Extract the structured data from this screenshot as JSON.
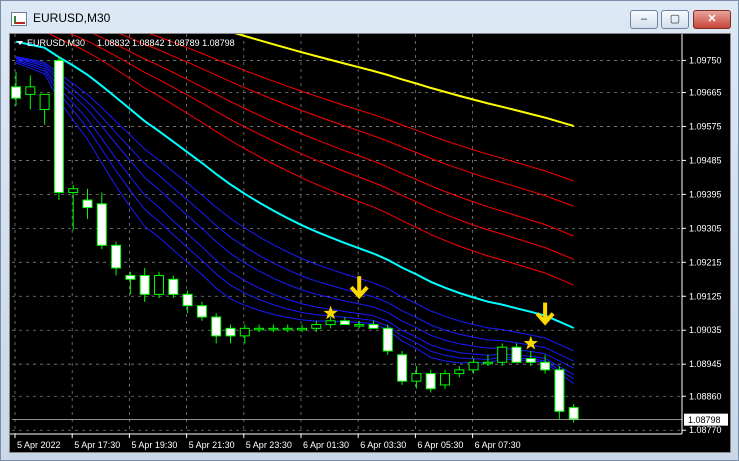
{
  "window": {
    "title": "EURUSD,M30"
  },
  "controls": {
    "minimize": "‒",
    "maximize": "▢",
    "close": "✕"
  },
  "chart_data": {
    "type": "candlestick",
    "title": "EURUSD,M30",
    "ohlc_header": "1.08832 1.08842 1.08789 1.08798",
    "current_price": "1.08798",
    "y_ticks": [
      "1.09750",
      "1.09665",
      "1.09575",
      "1.09485",
      "1.09395",
      "1.09305",
      "1.09215",
      "1.09125",
      "1.09035",
      "1.08945",
      "1.08860",
      "1.08770"
    ],
    "y_ticks_num": [
      1.0975,
      1.09665,
      1.09575,
      1.09485,
      1.09395,
      1.09305,
      1.09215,
      1.09125,
      1.09035,
      1.08945,
      1.0886,
      1.0877
    ],
    "x_ticks": [
      "5 Apr 2022",
      "5 Apr 17:30",
      "5 Apr 19:30",
      "5 Apr 21:30",
      "5 Apr 23:30",
      "6 Apr 01:30",
      "6 Apr 03:30",
      "6 Apr 05:30",
      "6 Apr 07:30"
    ],
    "ylim": [
      1.0876,
      1.0982
    ],
    "candles": [
      [
        1.0968,
        1.0972,
        1.0963,
        1.0965
      ],
      [
        1.0966,
        1.0971,
        1.0962,
        1.0968
      ],
      [
        1.0962,
        1.0966,
        1.0958,
        1.0966
      ],
      [
        1.0975,
        1.0976,
        1.0938,
        1.094
      ],
      [
        1.094,
        1.0942,
        1.093,
        1.0941
      ],
      [
        1.0938,
        1.0941,
        1.0933,
        1.0936
      ],
      [
        1.0937,
        1.094,
        1.0925,
        1.0926
      ],
      [
        1.0926,
        1.0927,
        1.0918,
        1.092
      ],
      [
        1.0918,
        1.0919,
        1.0913,
        1.0917
      ],
      [
        1.0918,
        1.092,
        1.0911,
        1.0913
      ],
      [
        1.0913,
        1.0919,
        1.0912,
        1.0918
      ],
      [
        1.0917,
        1.0918,
        1.0912,
        1.0913
      ],
      [
        1.0913,
        1.0914,
        1.0908,
        1.091
      ],
      [
        1.091,
        1.0911,
        1.0906,
        1.0907
      ],
      [
        1.0907,
        1.0908,
        1.09,
        1.0902
      ],
      [
        1.0904,
        1.0905,
        1.09,
        1.0902
      ],
      [
        1.0902,
        1.0905,
        1.09,
        1.0904
      ],
      [
        1.0904,
        1.0905,
        1.0903,
        1.0904
      ],
      [
        1.0904,
        1.0905,
        1.0903,
        1.0904
      ],
      [
        1.0904,
        1.0905,
        1.0903,
        1.0904
      ],
      [
        1.0904,
        1.0905,
        1.0903,
        1.0904
      ],
      [
        1.0904,
        1.0906,
        1.0903,
        1.0905
      ],
      [
        1.0905,
        1.0907,
        1.0904,
        1.0906
      ],
      [
        1.0906,
        1.0907,
        1.0905,
        1.0905
      ],
      [
        1.0905,
        1.0906,
        1.0904,
        1.0905
      ],
      [
        1.0905,
        1.0906,
        1.0904,
        1.0904
      ],
      [
        1.0904,
        1.0905,
        1.0897,
        1.0898
      ],
      [
        1.0897,
        1.0898,
        1.0889,
        1.089
      ],
      [
        1.089,
        1.0894,
        1.0888,
        1.0892
      ],
      [
        1.0892,
        1.0893,
        1.0887,
        1.0888
      ],
      [
        1.0889,
        1.0893,
        1.0888,
        1.0892
      ],
      [
        1.0892,
        1.0894,
        1.0891,
        1.0893
      ],
      [
        1.0893,
        1.0896,
        1.0892,
        1.0895
      ],
      [
        1.0895,
        1.0897,
        1.0894,
        1.0895
      ],
      [
        1.0895,
        1.09,
        1.0894,
        1.0899
      ],
      [
        1.0899,
        1.09,
        1.0895,
        1.0895
      ],
      [
        1.0896,
        1.0898,
        1.0894,
        1.0895
      ],
      [
        1.0895,
        1.0897,
        1.0892,
        1.0893
      ],
      [
        1.0893,
        1.0894,
        1.088,
        1.0882
      ],
      [
        1.0883,
        1.0884,
        1.0879,
        1.088
      ]
    ],
    "signals": [
      {
        "type": "star",
        "candle": 22,
        "price": 1.0908
      },
      {
        "type": "arrow-down",
        "candle": 24,
        "price": 1.0912
      },
      {
        "type": "star",
        "candle": 36,
        "price": 1.09
      },
      {
        "type": "arrow-down",
        "candle": 37,
        "price": 1.0905
      }
    ],
    "colors": {
      "background": "#000000",
      "grid": "#7f7f7f",
      "bull": "#00ff00",
      "bear": "#ffffff",
      "ma_slow": "#ffff00",
      "ma_cyan": "#00ffff",
      "ma_red": "#ff0000",
      "ma_blue": "#1a1aff",
      "signal": "#ffd700",
      "axis_text": "#ffffff"
    },
    "grid": true
  }
}
